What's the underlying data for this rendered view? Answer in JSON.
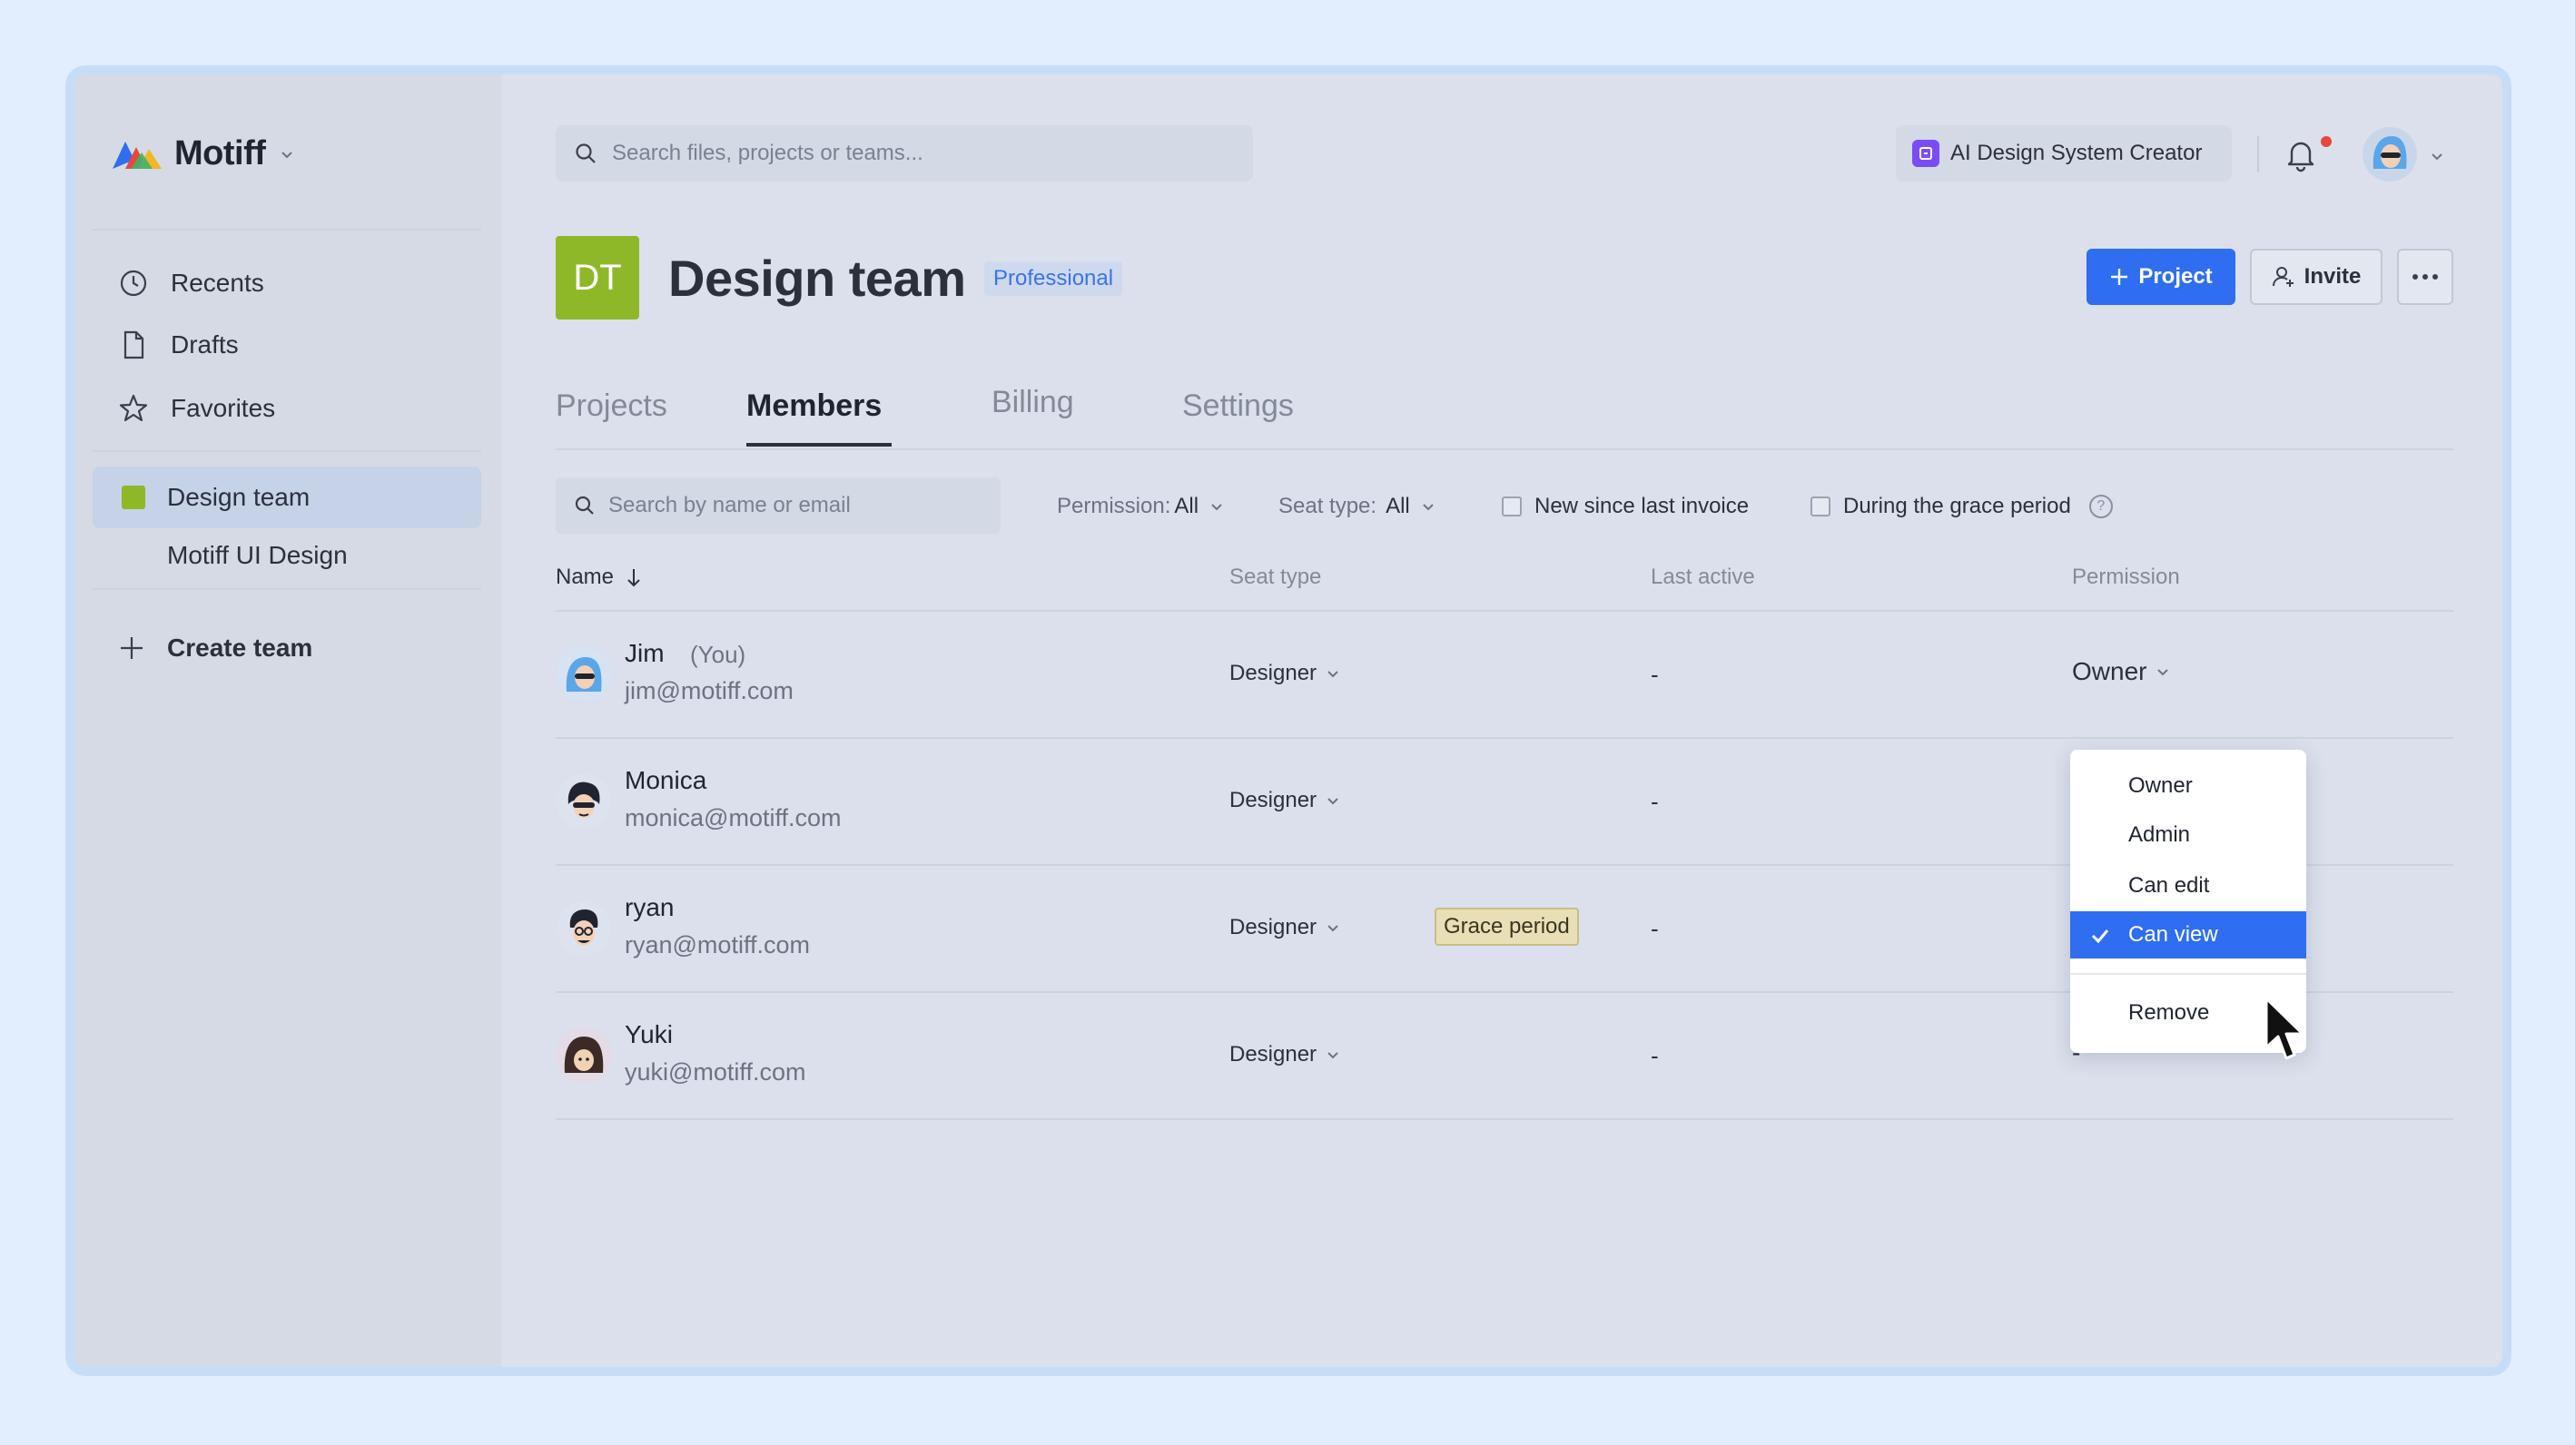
{
  "app": {
    "name": "Motiff"
  },
  "sidebar": {
    "nav": [
      {
        "label": "Recents",
        "icon": "clock-icon"
      },
      {
        "label": "Drafts",
        "icon": "document-icon"
      },
      {
        "label": "Favorites",
        "icon": "star-icon"
      }
    ],
    "team": {
      "label": "Design team",
      "color": "#8fb828"
    },
    "team_project": "Motiff UI Design",
    "create_team": "Create team"
  },
  "topbar": {
    "search_placeholder": "Search files, projects or teams...",
    "ai_button": "AI Design System Creator"
  },
  "header": {
    "initials": "DT",
    "title": "Design team",
    "plan": "Professional",
    "project_button": "Project",
    "invite_button": "Invite"
  },
  "tabs": [
    "Projects",
    "Members",
    "Billing",
    "Settings"
  ],
  "active_tab": "Members",
  "filters": {
    "search_placeholder": "Search by name or email",
    "permission_label": "Permission:",
    "permission_value": "All",
    "seat_label": "Seat type:",
    "seat_value": "All",
    "new_since_invoice": "New since last invoice",
    "grace_period": "During the grace period",
    "help": "?"
  },
  "table": {
    "columns": [
      "Name",
      "Seat type",
      "Last active",
      "Permission"
    ],
    "rows": [
      {
        "name": "Jim",
        "you": "(You)",
        "email": "jim@motiff.com",
        "seat": "Designer",
        "last_active": "-",
        "permission": "Owner"
      },
      {
        "name": "Monica",
        "email": "monica@motiff.com",
        "seat": "Designer",
        "last_active": "-"
      },
      {
        "name": "ryan",
        "email": "ryan@motiff.com",
        "seat": "Designer",
        "badge": "Grace period",
        "last_active": "-"
      },
      {
        "name": "Yuki",
        "email": "yuki@motiff.com",
        "seat": "Designer",
        "last_active": "-",
        "permission": "-"
      }
    ]
  },
  "permission_menu": {
    "options": [
      "Owner",
      "Admin",
      "Can edit",
      "Can view"
    ],
    "selected": "Can view",
    "remove": "Remove"
  },
  "colors": {
    "accent": "#2f6ef0",
    "team": "#8fb828",
    "notification": "#e5483d"
  }
}
